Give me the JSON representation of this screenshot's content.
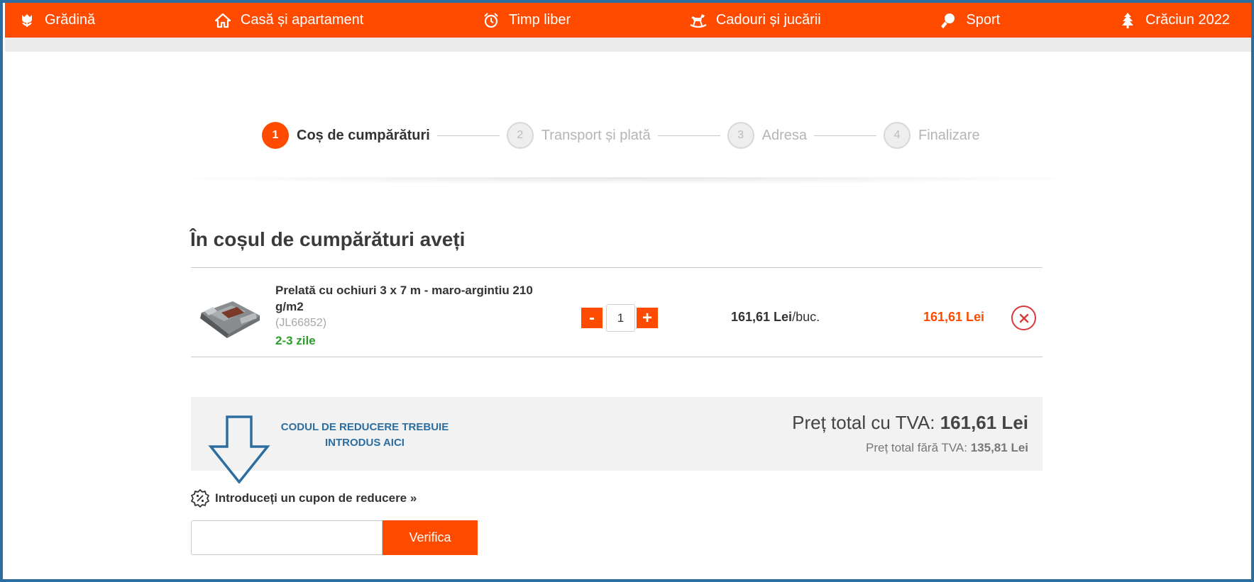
{
  "topnav": {
    "items": [
      {
        "label": "Grădină",
        "icon": "tulip-icon"
      },
      {
        "label": "Casă și apartament",
        "icon": "house-icon"
      },
      {
        "label": "Timp liber",
        "icon": "alarm-clock-icon"
      },
      {
        "label": "Cadouri și jucării",
        "icon": "rocking-horse-icon"
      },
      {
        "label": "Sport",
        "icon": "ping-pong-icon"
      },
      {
        "label": "Crăciun 2022",
        "icon": "christmas-tree-icon"
      }
    ]
  },
  "steps": [
    {
      "number": "1",
      "label": "Coș de cumpărături",
      "active": true
    },
    {
      "number": "2",
      "label": "Transport și plată",
      "active": false
    },
    {
      "number": "3",
      "label": "Adresa",
      "active": false
    },
    {
      "number": "4",
      "label": "Finalizare",
      "active": false
    }
  ],
  "cart": {
    "title": "În coșul de cumpărături aveți",
    "items": [
      {
        "name": "Prelată cu ochiuri 3 x 7 m - maro-argintiu 210 g/m2",
        "code": "(JL66852)",
        "delivery": "2-3 zile",
        "quantity": "1",
        "qty_minus": "-",
        "qty_plus": "+",
        "unit_price": "161,61 Lei",
        "unit_suffix": "/buc.",
        "line_total": "161,61 Lei"
      }
    ]
  },
  "totals": {
    "with_vat_label": "Preț total cu TVA: ",
    "with_vat_value": "161,61 Lei",
    "without_vat_label": "Preț total fără TVA: ",
    "without_vat_value": "135,81 Lei"
  },
  "annotation": {
    "line1": "CODUL DE REDUCERE TREBUIE",
    "line2": "INTRODUS AICI"
  },
  "coupon": {
    "link_text": "Introduceți un cupon de reducere »",
    "input_value": "",
    "button_label": "Verifica"
  },
  "colors": {
    "brand_orange": "#fe4b00",
    "frame_blue": "#2c6ea0",
    "delivery_green": "#2aa02a",
    "remove_red": "#d9383a"
  }
}
